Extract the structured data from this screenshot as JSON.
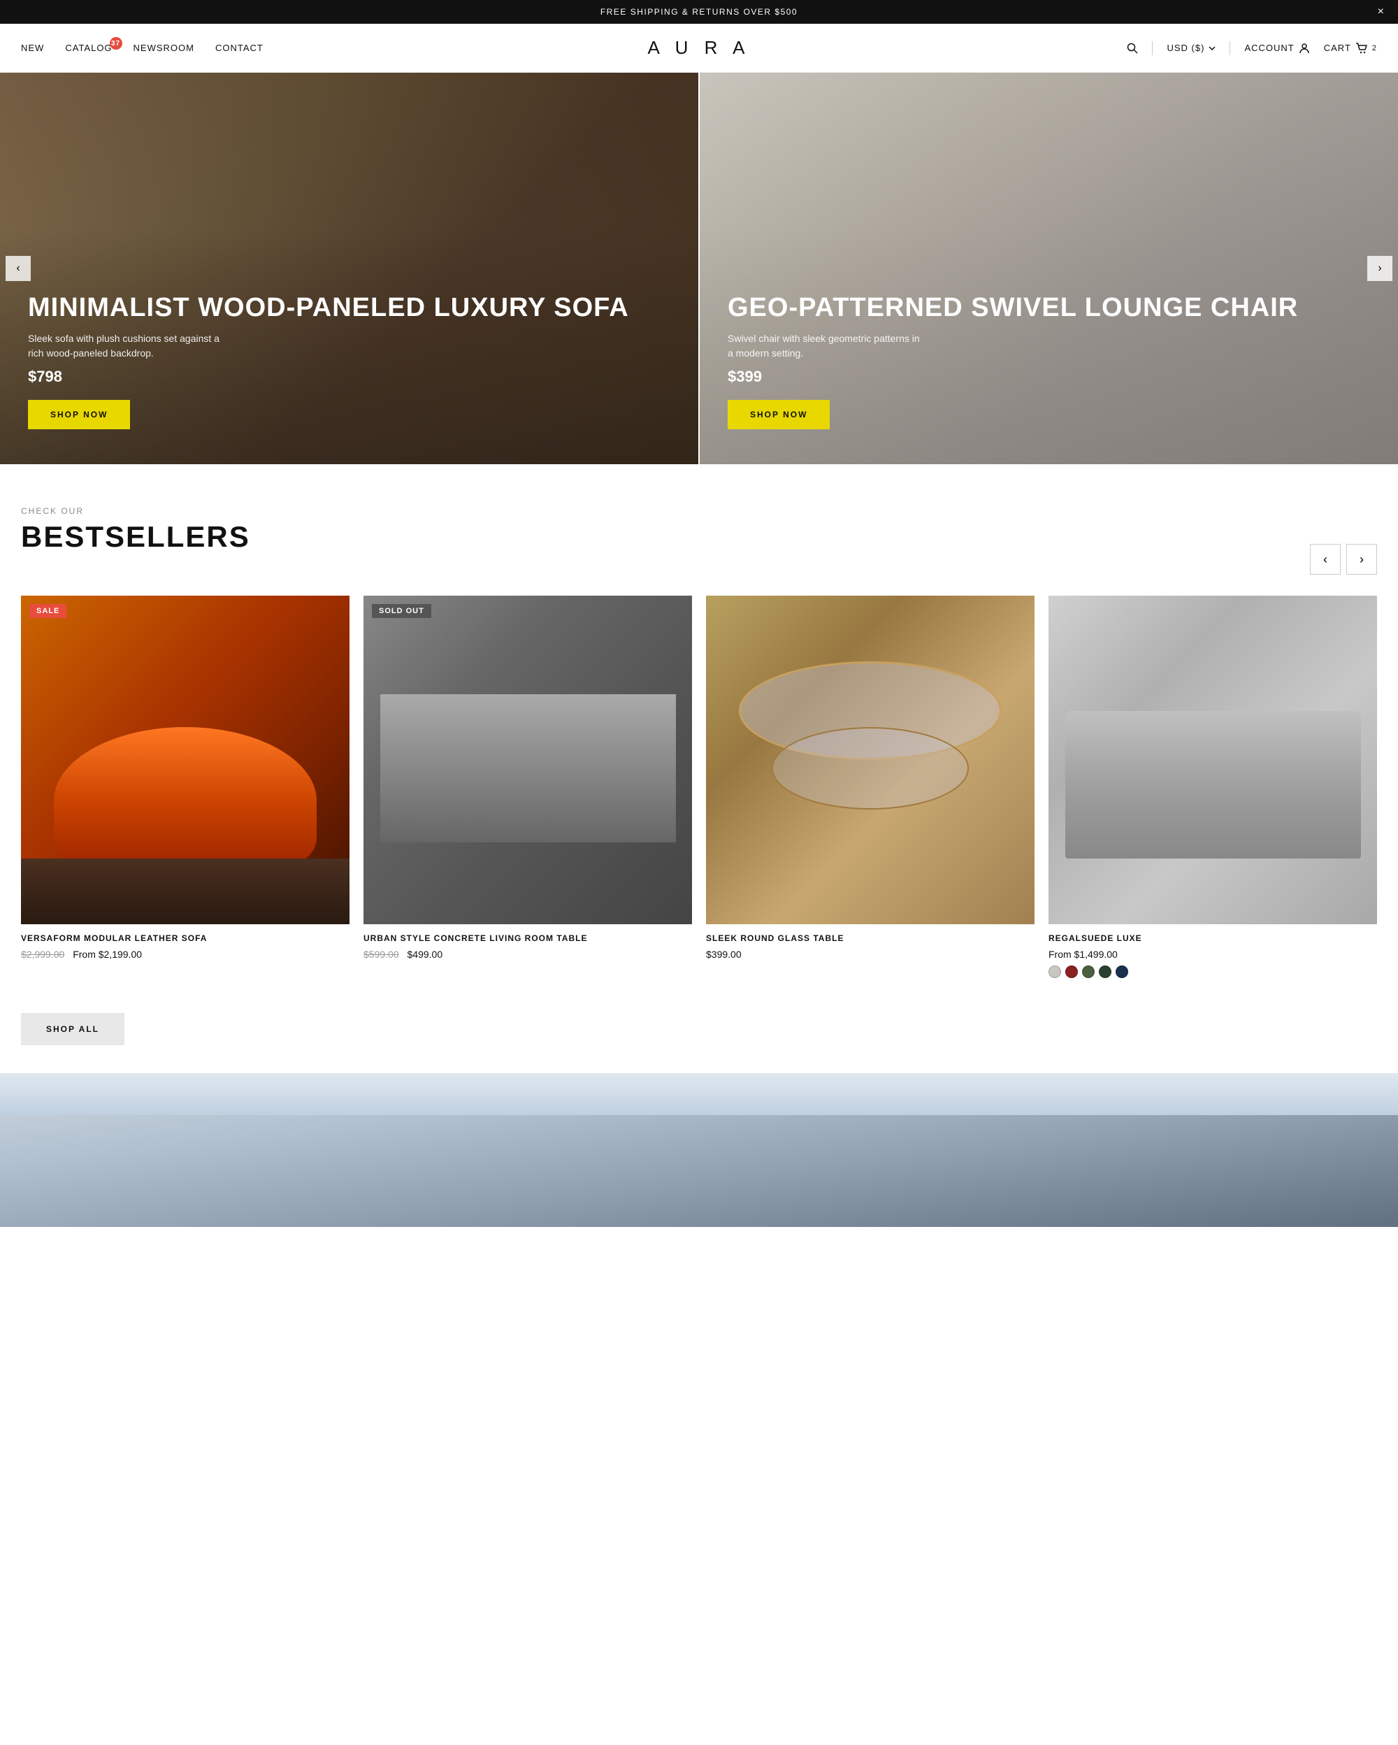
{
  "announcement": {
    "text": "FREE SHIPPING & RETURNS OVER $500",
    "close_label": "×"
  },
  "header": {
    "nav_left": [
      {
        "id": "new",
        "label": "NEW"
      },
      {
        "id": "catalog",
        "label": "CATALOG",
        "badge": "37"
      },
      {
        "id": "newsroom",
        "label": "NEWSROOM"
      },
      {
        "id": "contact",
        "label": "CONTACT"
      }
    ],
    "logo": "A U R A",
    "currency_label": "USD ($)",
    "account_label": "ACCOUNT",
    "cart_label": "CART",
    "cart_count": "2"
  },
  "hero": {
    "prev_label": "‹",
    "next_label": "›",
    "panels": [
      {
        "id": "hero-left",
        "title": "MINIMALIST WOOD-PANELED LUXURY SOFA",
        "description": "Sleek sofa with plush cushions set against a rich wood-paneled backdrop.",
        "price": "$798",
        "btn_label": "SHOP NOW"
      },
      {
        "id": "hero-right",
        "title": "GEO-PATTERNED SWIVEL LOUNGE CHAIR",
        "description": "Swivel chair with sleek geometric patterns in a modern setting.",
        "price": "$399",
        "btn_label": "SHOP NOW"
      }
    ]
  },
  "bestsellers": {
    "sub_label": "CHECK OUR",
    "title": "BESTSELLERS",
    "prev_label": "‹",
    "next_label": "›",
    "products": [
      {
        "id": "versaform-sofa",
        "name": "VERSAFORM MODULAR LEATHER SOFA",
        "badge": "SALE",
        "badge_type": "sale",
        "old_price": "$2,999.00",
        "new_price": "From $2,199.00",
        "image_type": "sofa-orange",
        "swatches": []
      },
      {
        "id": "concrete-table",
        "name": "URBAN STYLE CONCRETE LIVING ROOM TABLE",
        "badge": "SOLD OUT",
        "badge_type": "sold-out",
        "old_price": "$599.00",
        "new_price": "$499.00",
        "image_type": "concrete-table",
        "swatches": []
      },
      {
        "id": "glass-table",
        "name": "SLEEK ROUND GLASS TABLE",
        "badge": null,
        "old_price": null,
        "new_price": "$399.00",
        "image_type": "glass-table",
        "swatches": []
      },
      {
        "id": "regalsuede",
        "name": "REGALSUEDE LUXE",
        "badge": null,
        "old_price": null,
        "new_price": "From $1,499.00",
        "image_type": "gray-sofa",
        "swatches": [
          {
            "color": "#c8c8c0"
          },
          {
            "color": "#8B2020"
          },
          {
            "color": "#4a6040"
          },
          {
            "color": "#2a4030"
          },
          {
            "color": "#1a3050"
          }
        ]
      }
    ],
    "shop_all_label": "SHOP ALL"
  },
  "colors": {
    "accent_yellow": "#e8d800",
    "badge_sale": "#e74c3c",
    "badge_sold_out": "#555555"
  }
}
